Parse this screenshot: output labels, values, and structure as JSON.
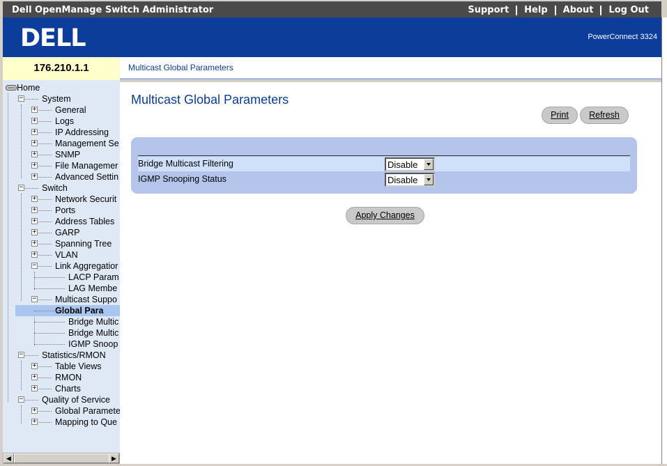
{
  "header": {
    "app_title": "Dell OpenManage Switch Administrator",
    "links": [
      "Support",
      "Help",
      "About",
      "Log Out"
    ],
    "logo_text": "DELL",
    "product": "PowerConnect 3324"
  },
  "ip_address": "176.210.1.1",
  "breadcrumb": "Multicast Global Parameters",
  "nav": {
    "items": [
      {
        "label": "Home"
      },
      {
        "label": "System"
      },
      {
        "label": "General"
      },
      {
        "label": "Logs"
      },
      {
        "label": "IP Addressing"
      },
      {
        "label": "Management Se"
      },
      {
        "label": "SNMP"
      },
      {
        "label": "File Managemer"
      },
      {
        "label": "Advanced Settin"
      },
      {
        "label": "Switch"
      },
      {
        "label": "Network Securit"
      },
      {
        "label": "Ports"
      },
      {
        "label": "Address Tables"
      },
      {
        "label": "GARP"
      },
      {
        "label": "Spanning Tree"
      },
      {
        "label": "VLAN"
      },
      {
        "label": "Link Aggregatior"
      },
      {
        "label": "LACP Param"
      },
      {
        "label": "LAG Membe"
      },
      {
        "label": "Multicast Suppo"
      },
      {
        "label": "Global Para"
      },
      {
        "label": "Bridge Multic"
      },
      {
        "label": "Bridge Multic"
      },
      {
        "label": "IGMP Snoop"
      },
      {
        "label": "Statistics/RMON"
      },
      {
        "label": "Table Views"
      },
      {
        "label": "RMON"
      },
      {
        "label": "Charts"
      },
      {
        "label": "Quality of Service"
      },
      {
        "label": "Global Paramete"
      },
      {
        "label": "Mapping to Que"
      }
    ]
  },
  "main": {
    "title": "Multicast Global Parameters",
    "print_label": "Print",
    "refresh_label": "Refresh",
    "fields": [
      {
        "label": "Bridge Multicast Filtering",
        "value": "Disable"
      },
      {
        "label": "IGMP Snooping Status",
        "value": "Disable"
      }
    ],
    "apply_label": "Apply Changes"
  },
  "colors": {
    "banner": "#0c3d9b",
    "title_blue": "#0b3d91",
    "panel": "#b4c4ea",
    "nav_bg": "#dfe8f5",
    "selected": "#a8c6f0"
  }
}
